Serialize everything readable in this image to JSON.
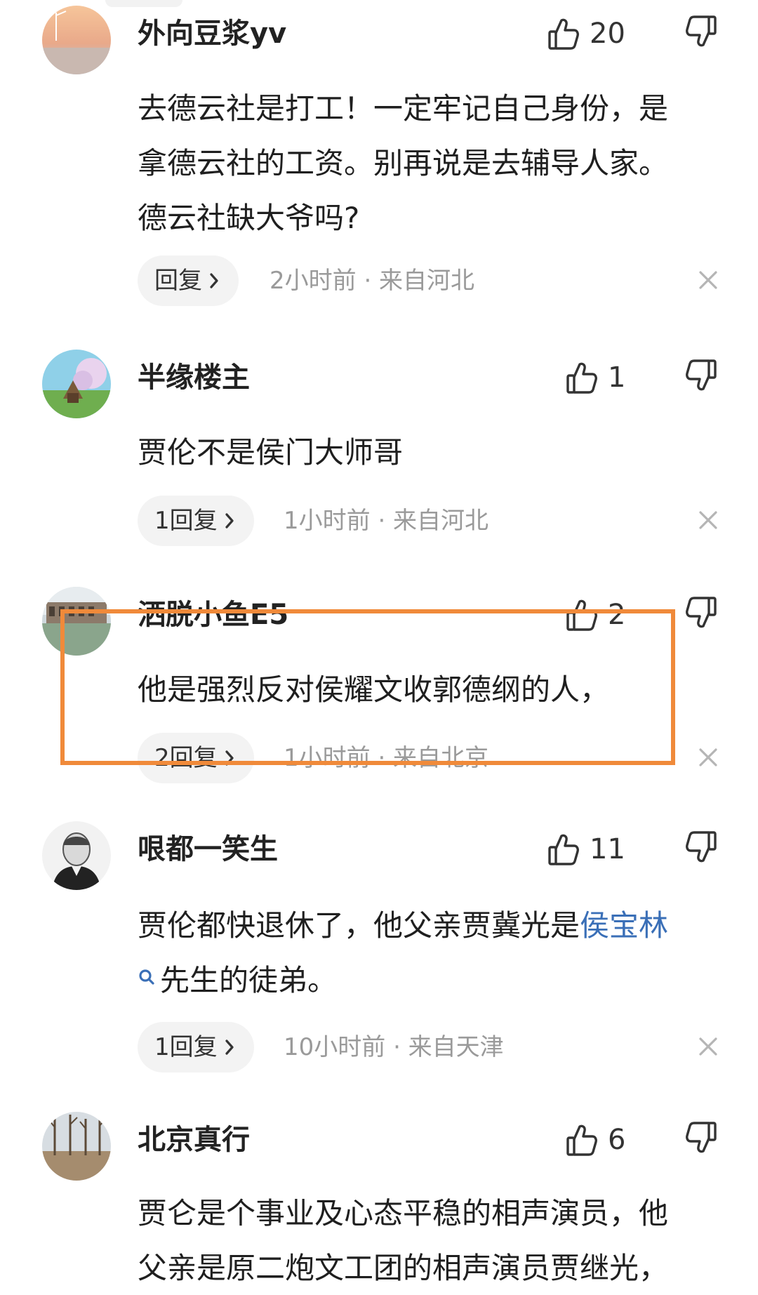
{
  "comments": [
    {
      "username": "外向豆浆yv",
      "likes": "20",
      "text_lines": [
        "去德云社是打工！一定牢记自己身份，是",
        "拿德云社的工资。别再说是去辅导人家。",
        "德云社缺大爷吗?"
      ],
      "reply_label": "回复",
      "time": "2小时前 · 来自河北"
    },
    {
      "username": "半缘楼主",
      "likes": "1",
      "text_lines": [
        "贾伦不是侯门大师哥"
      ],
      "reply_label": "1回复",
      "time": "1小时前 · 来自河北"
    },
    {
      "username": "洒脱小鱼E5",
      "likes": "2",
      "text_lines": [
        "他是强烈反对侯耀文收郭德纲的人，"
      ],
      "reply_label": "2回复",
      "time": "1小时前 · 来自北京"
    },
    {
      "username": "哏都一笑生",
      "likes": "11",
      "text_line1_before": "贾伦都快退休了，他父亲贾冀光是",
      "mention": "侯宝林",
      "text_line2": "先生的徒弟。",
      "reply_label": "1回复",
      "time": "10小时前 · 来自天津"
    },
    {
      "username": "北京真行",
      "likes": "6",
      "text_lines": [
        "贾仑是个事业及心态平稳的相声演员，他",
        "父亲是原二炮文工团的相声演员贾继光，"
      ]
    }
  ],
  "colors": {
    "highlight_border": "#f08a3a",
    "mention": "#3a6fb7",
    "meta_text": "#9a9a9a",
    "pill_bg": "#f3f3f3"
  },
  "icons": {
    "like": "thumbs-up-icon",
    "dislike": "thumbs-down-icon",
    "close": "close-icon",
    "chevron": "chevron-right-icon",
    "search": "search-icon"
  }
}
